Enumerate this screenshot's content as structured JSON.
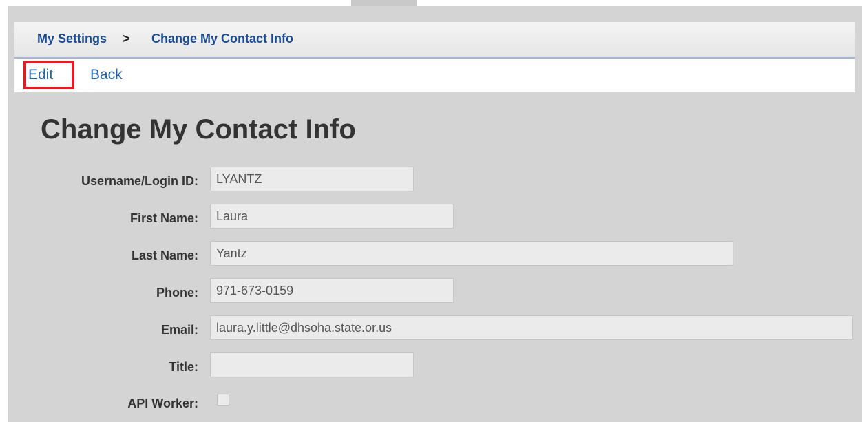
{
  "breadcrumb": {
    "parent": "My Settings",
    "separator": ">",
    "current": "Change My Contact Info"
  },
  "actions": {
    "edit_label": "Edit",
    "back_label": "Back"
  },
  "page": {
    "title": "Change My Contact Info"
  },
  "form": {
    "username_label": "Username/Login ID:",
    "username_value": "LYANTZ",
    "first_name_label": "First Name:",
    "first_name_value": "Laura",
    "last_name_label": "Last Name:",
    "last_name_value": "Yantz",
    "phone_label": "Phone:",
    "phone_value": "971-673-0159",
    "email_label": "Email:",
    "email_value": "laura.y.little@dhsoha.state.or.us",
    "title_label": "Title:",
    "title_value": "",
    "api_worker_label": "API Worker:",
    "api_worker_checked": false
  },
  "colors": {
    "link": "#1f63b4",
    "breadcrumb_link": "#1c4d94",
    "highlight_border": "#e01c24",
    "panel_background": "#d4d4d4"
  }
}
